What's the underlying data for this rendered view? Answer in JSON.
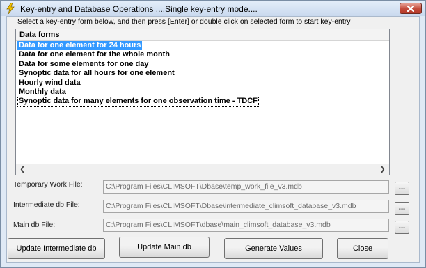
{
  "window": {
    "title": "Key-entry and Database Operations ....Single key-entry mode....",
    "app_icon": "lightning-icon",
    "close_icon": "close-x-icon"
  },
  "instruction": "Select a key-entry form below, and then press [Enter] or double click on selected form to start key-entry",
  "list": {
    "column_header": "Data forms",
    "items": [
      "Data for one element for 24 hours",
      "Data for one element for the whole month",
      "Data for some elements for one day",
      "Synoptic data for all hours for one element",
      "Hourly wind data",
      "Monthly data",
      "Synoptic data for many elements for one  observation time - TDCF"
    ],
    "selected_index": 0,
    "focused_index": 6
  },
  "fields": {
    "temp": {
      "label": "Temporary Work File:",
      "value": "C:\\Program Files\\CLIMSOFT\\Dbase\\temp_work_file_v3.mdb"
    },
    "intermediate": {
      "label": "Intermediate db File:",
      "value": "C:\\Program Files\\CLIMSOFT\\Dbase\\intermediate_climsoft_database_v3.mdb"
    },
    "main": {
      "label": "Main db File:",
      "value": "C:\\Program Files\\CLIMSOFT\\dbase\\main_climsoft_database_v3.mdb"
    }
  },
  "browse_label": "...",
  "buttons": {
    "update_intermediate": "Update Intermediate  db",
    "update_main": "Update Main db",
    "generate_values": "Generate Values",
    "close": "Close"
  },
  "colors": {
    "selection": "#3399ff",
    "title_close": "#c34a3a"
  }
}
